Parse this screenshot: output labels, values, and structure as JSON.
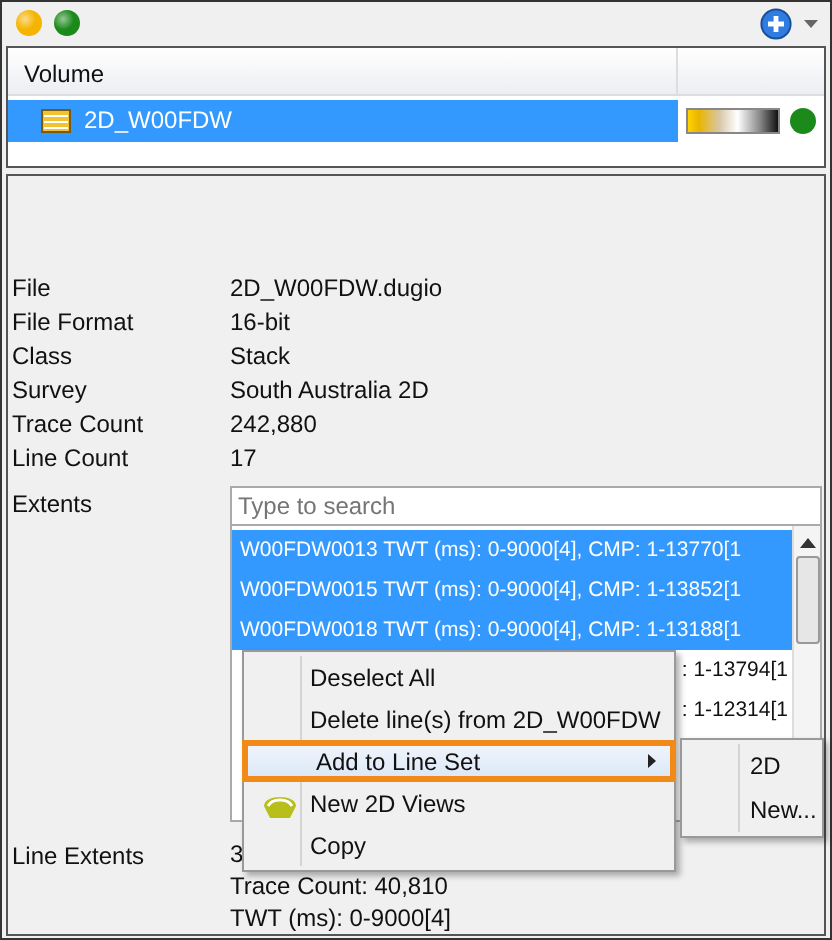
{
  "toolbar": {
    "status_dots": [
      {
        "color": "#f5b400"
      },
      {
        "color": "#1b8a1b"
      }
    ]
  },
  "volume_table": {
    "columns": [
      "Volume"
    ],
    "rows": [
      {
        "name": "2D_W00FDW",
        "selected": true,
        "color": "#1b8a1b"
      }
    ]
  },
  "properties": [
    {
      "label": "File",
      "value": "2D_W00FDW.dugio"
    },
    {
      "label": "File Format",
      "value": "16-bit"
    },
    {
      "label": "Class",
      "value": "Stack"
    },
    {
      "label": "Survey",
      "value": "South Australia 2D"
    },
    {
      "label": "Trace Count",
      "value": "242,880"
    },
    {
      "label": "Line Count",
      "value": "17"
    }
  ],
  "extents": {
    "label": "Extents",
    "search": {
      "placeholder": "Type to search"
    },
    "lines": [
      {
        "text": "W00FDW0013 TWT (ms): 0-9000[4], CMP: 1-13770[1",
        "selected": true,
        "kind": "full"
      },
      {
        "text": "W00FDW0015 TWT (ms): 0-9000[4], CMP: 1-13852[1",
        "selected": true,
        "kind": "full"
      },
      {
        "text": "W00FDW0018 TWT (ms): 0-9000[4], CMP: 1-13188[1",
        "selected": true,
        "kind": "full"
      },
      {
        "text": ": 1-13794[1",
        "selected": false,
        "kind": "partial"
      },
      {
        "text": ": 1-12314[1",
        "selected": false,
        "kind": "partial"
      }
    ]
  },
  "line_extents": {
    "label": "Line Extents",
    "lines": [
      "3",
      "Trace Count: 40,810",
      "TWT (ms): 0-9000[4]"
    ]
  },
  "context_menu": {
    "items": [
      {
        "label": "Deselect All",
        "highlighted": false,
        "has_submenu": false,
        "has_icon": false
      },
      {
        "label": "Delete line(s) from 2D_W00FDW",
        "highlighted": false,
        "has_submenu": false,
        "has_icon": false
      },
      {
        "label": "Add to Line Set",
        "highlighted": true,
        "has_submenu": true,
        "has_icon": false
      },
      {
        "label": "New 2D Views",
        "highlighted": false,
        "has_submenu": false,
        "has_icon": true
      },
      {
        "label": "Copy",
        "highlighted": false,
        "has_submenu": false,
        "has_icon": false
      }
    ],
    "submenu": {
      "items": [
        "2D",
        "New..."
      ]
    }
  }
}
